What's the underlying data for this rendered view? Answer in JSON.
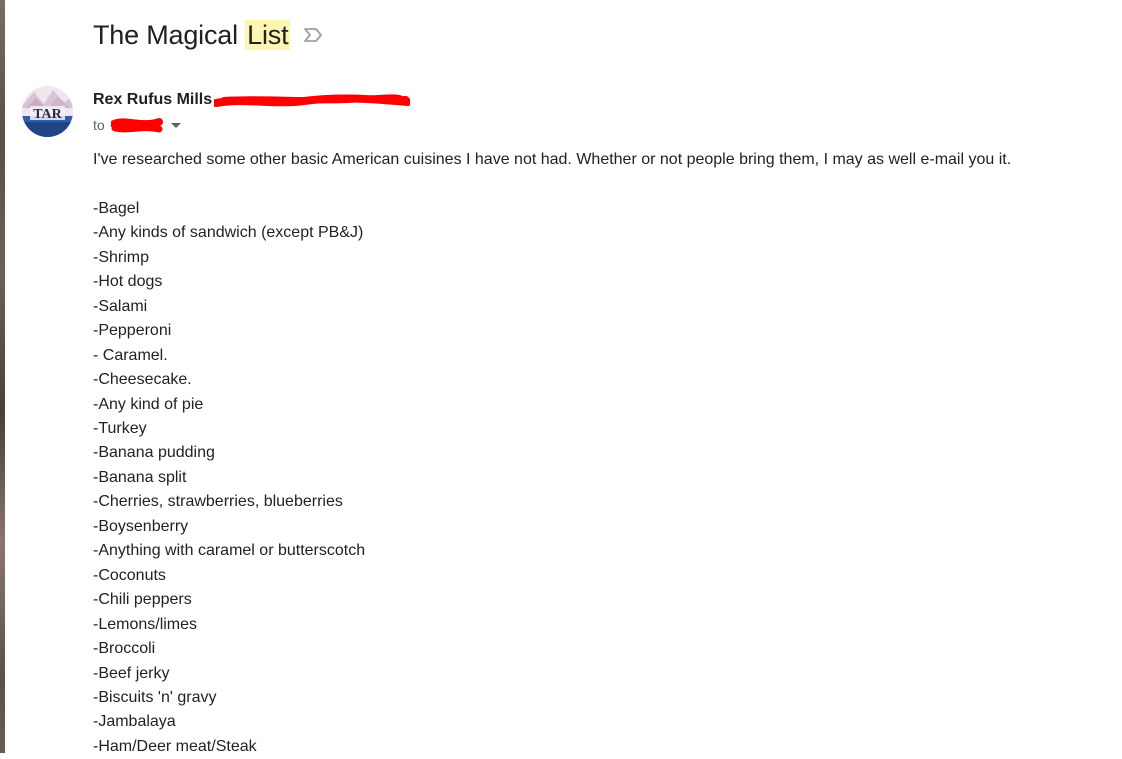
{
  "email": {
    "subject_prefix": "The Magical ",
    "subject_highlight": "List",
    "sender_name": "Rex Rufus Mills",
    "to_label": "to",
    "intro": "I've researched some other basic American cuisines I have not had. Whether or not people bring them, I may as well e-mail you it.",
    "items": [
      "-Bagel",
      "-Any kinds of sandwich (except PB&J)",
      "-Shrimp",
      "-Hot dogs",
      "-Salami",
      "-Pepperoni",
      "- Caramel.",
      "-Cheesecake.",
      "-Any kind of pie",
      "-Turkey",
      "-Banana pudding",
      "-Banana split",
      "-Cherries, strawberries, blueberries",
      "-Boysenberry",
      "-Anything with caramel or butterscotch",
      "-Coconuts",
      "-Chili peppers",
      "-Lemons/limes",
      "-Broccoli",
      "-Beef jerky",
      "-Biscuits 'n' gravy",
      "-Jambalaya",
      "-Ham/Deer meat/Steak"
    ]
  },
  "avatar": {
    "initials": "TAR"
  },
  "icons": {
    "important_marker": "important-label-icon",
    "recipient_details": "chevron-down-icon"
  },
  "colors": {
    "subject_highlight": "#fdf6b1",
    "redaction": "#ff0000",
    "text": "#222222",
    "muted": "#5f6368"
  }
}
